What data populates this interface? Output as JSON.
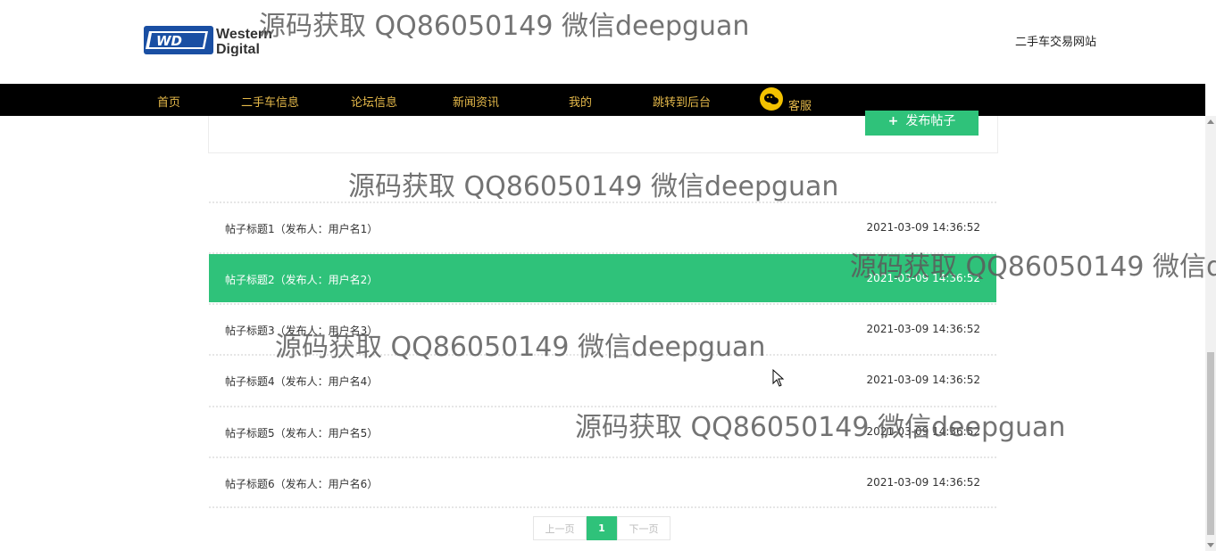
{
  "header": {
    "logo_line1": "Western",
    "logo_line2": "Digital",
    "logo_mark": "WD",
    "site_name": "二手车交易网站"
  },
  "nav": [
    {
      "label": "首页"
    },
    {
      "label": "二手车信息"
    },
    {
      "label": "论坛信息"
    },
    {
      "label": "新闻资讯"
    },
    {
      "label": "我的"
    },
    {
      "label": "跳转到后台"
    },
    {
      "label": "客服",
      "icon": "wechat-icon"
    }
  ],
  "publish_button": {
    "label": "发布帖子",
    "icon": "plus-icon"
  },
  "posts": [
    {
      "title": "帖子标题1（发布人：用户名1）",
      "time": "2021-03-09 14:36:52"
    },
    {
      "title": "帖子标题2（发布人：用户名2）",
      "time": "2021-03-09 14:36:52",
      "active": true
    },
    {
      "title": "帖子标题3（发布人：用户名3）",
      "time": "2021-03-09 14:36:52"
    },
    {
      "title": "帖子标题4（发布人：用户名4）",
      "time": "2021-03-09 14:36:52"
    },
    {
      "title": "帖子标题5（发布人：用户名5）",
      "time": "2021-03-09 14:36:52"
    },
    {
      "title": "帖子标题6（发布人：用户名6）",
      "time": "2021-03-09 14:36:52"
    }
  ],
  "pagination": {
    "prev": "上一页",
    "current": "1",
    "next": "下一页"
  },
  "watermark": "源码获取 QQ86050149 微信deepguan",
  "watermark_clipped": "源码获取 QQ86050149 微信d",
  "colors": {
    "accent": "#2fc27a",
    "nav_bg": "#000000",
    "nav_text": "#e5b94a"
  }
}
